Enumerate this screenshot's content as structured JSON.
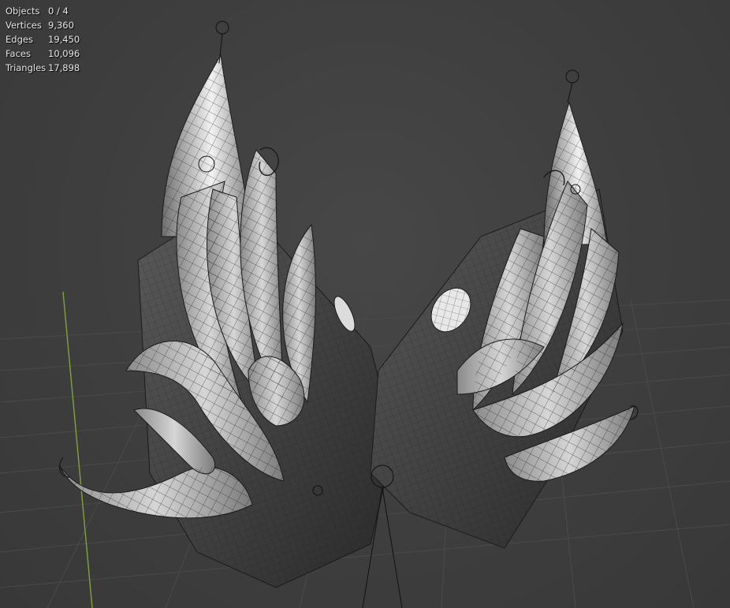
{
  "viewport": {
    "background_color": "#3d3d3d",
    "grid_color": "#4a4a4a",
    "y_axis_color": "#7fa33a",
    "mesh_fill_color": "#b9b9b9",
    "wire_color": "#1b1b1b"
  },
  "statistics": [
    {
      "label": "Objects",
      "value": "0 / 4"
    },
    {
      "label": "Vertices",
      "value": "9,360"
    },
    {
      "label": "Edges",
      "value": "19,450"
    },
    {
      "label": "Faces",
      "value": "10,096"
    },
    {
      "label": "Triangles",
      "value": "17,898"
    }
  ]
}
